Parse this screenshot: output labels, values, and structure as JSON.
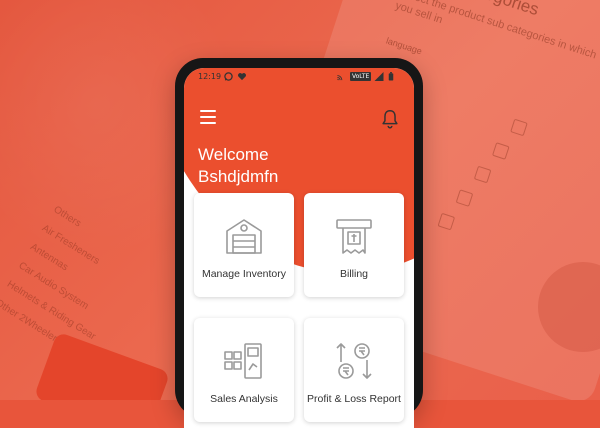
{
  "background": {
    "tablet_title": "Sub Categories",
    "tablet_subtitle": "Select the product sub categories in which you sell in",
    "tablet_language": "language",
    "list_items": [
      "Other 2Wheeler & 4 Wheeler",
      "Helmets & Riding Gear",
      "Car Audio System",
      "Antennas",
      "Air Fresheners",
      "Others"
    ]
  },
  "status_bar": {
    "time": "12:19",
    "icons": [
      "whatsapp-icon",
      "heart-icon",
      "cast-icon",
      "volte-badge",
      "signal-icon",
      "battery-icon"
    ],
    "volte": "VoLTE"
  },
  "header": {
    "menu_icon": "hamburger-menu-icon",
    "notification_icon": "bell-icon",
    "welcome_line1": "Welcome",
    "welcome_line2": "Bshdjdmfn"
  },
  "cards": [
    {
      "label": "Manage Inventory",
      "icon": "warehouse-icon"
    },
    {
      "label": "Billing",
      "icon": "receipt-icon"
    },
    {
      "label": "Sales Analysis",
      "icon": "calculator-chart-icon"
    },
    {
      "label": "Profit & Loss Report",
      "icon": "rupee-exchange-icon"
    }
  ],
  "colors": {
    "brand": "#eb4f2e",
    "icon_gray": "#9a9a9a",
    "card_text": "#333333"
  }
}
